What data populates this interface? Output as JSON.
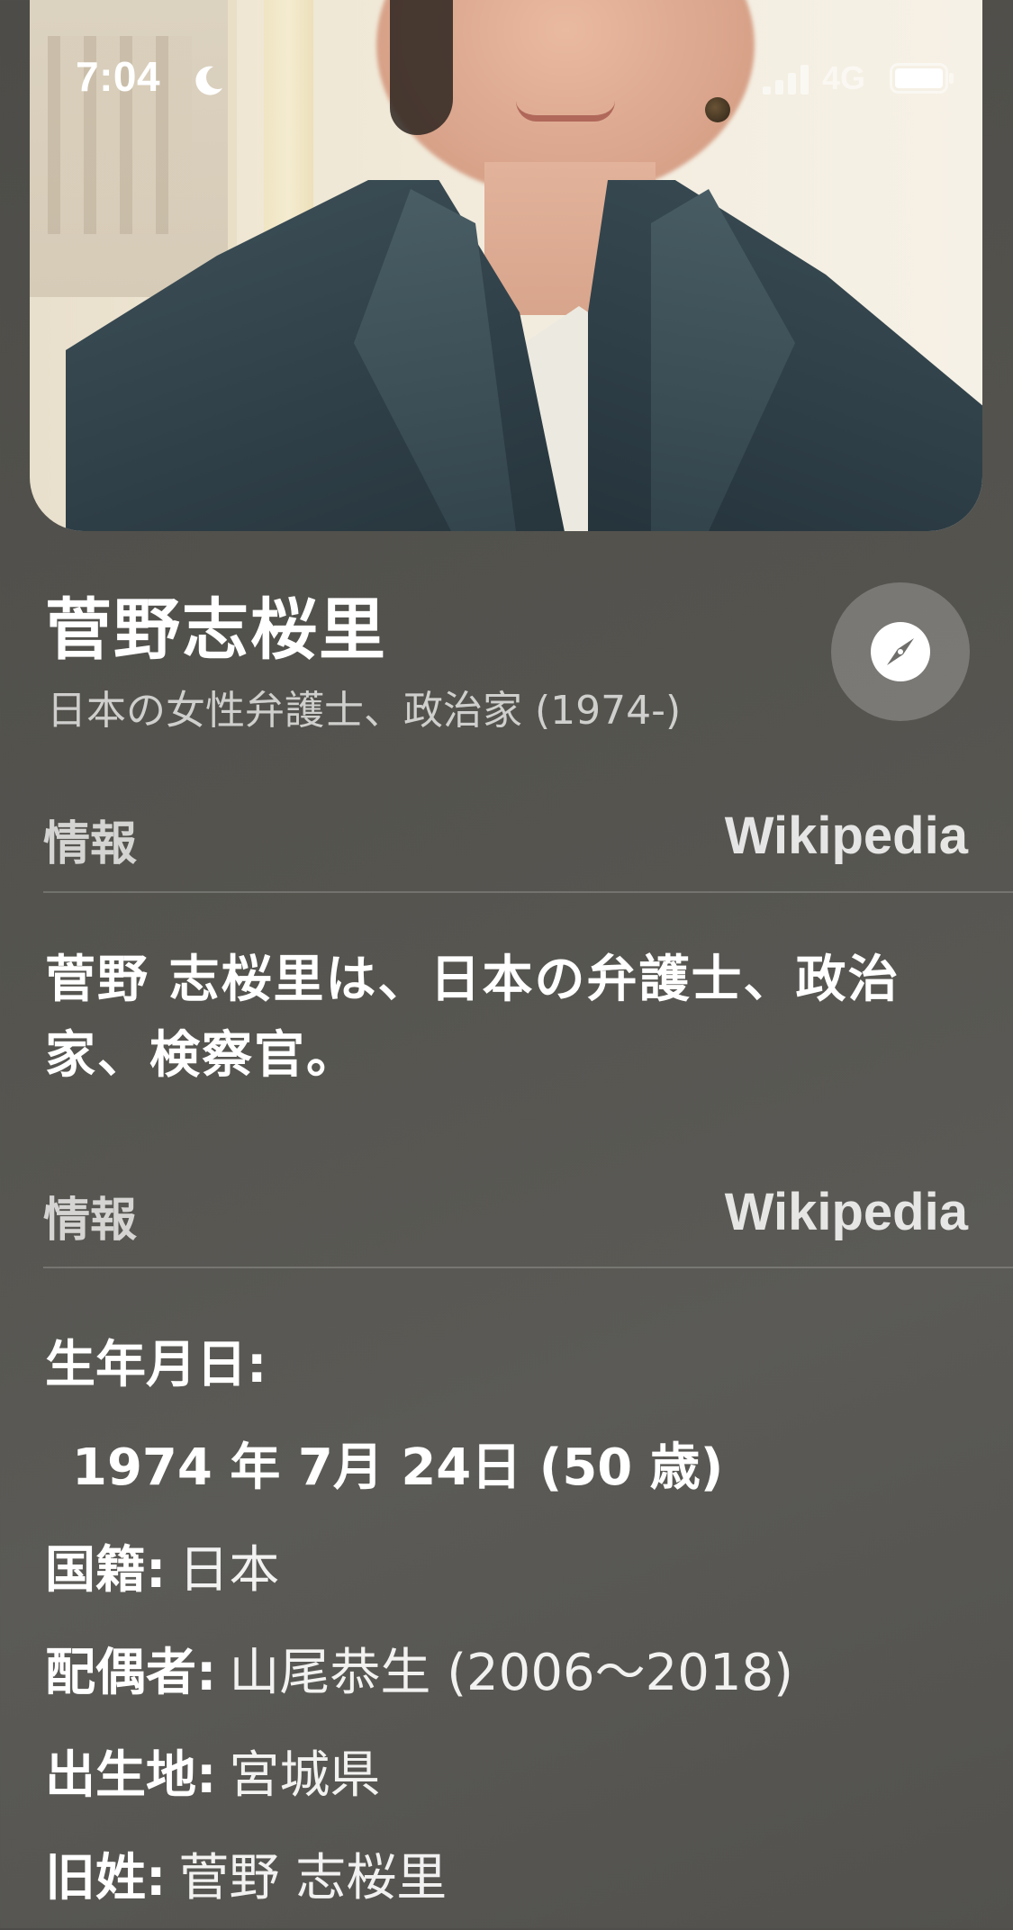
{
  "status_bar": {
    "time": "7:04",
    "network": "4G"
  },
  "header": {
    "title": "菅野志桜里",
    "subtitle": "日本の女性弁護士、政治家 (1974-)"
  },
  "sections": [
    {
      "label": "情報",
      "source": "Wikipedia",
      "summary": "菅野 志桜里は、日本の弁護士、政治家、検察官。"
    },
    {
      "label": "情報",
      "source": "Wikipedia",
      "facts": {
        "birth_date_label": "生年月日:",
        "birth_date_value": "1974 年 7月 24日 (50 歳)",
        "nationality_label": "国籍:",
        "nationality_value": "日本",
        "spouse_label": "配偶者:",
        "spouse_value": "山尾恭生 (2006～2018)",
        "birthplace_label": "出生地:",
        "birthplace_value": "宮城県",
        "former_name_label": "旧姓:",
        "former_name_value": "菅野 志桜里"
      }
    }
  ],
  "icons": {
    "moon": "moon-icon",
    "signal": "cellular-signal-icon",
    "battery": "battery-icon",
    "compass": "compass-icon"
  },
  "colors": {
    "background": "#55544f",
    "compass_button_bg": "#7a7975",
    "text_primary": "#ffffff"
  }
}
